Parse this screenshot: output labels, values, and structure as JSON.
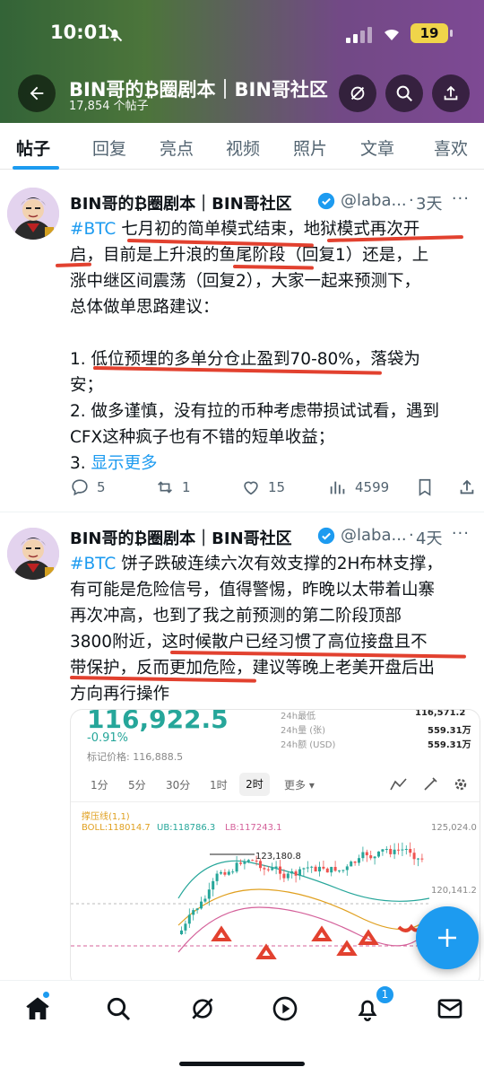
{
  "status_bar": {
    "time": "10:01",
    "battery": "19"
  },
  "header": {
    "title": "BIN哥的₿圈剧本｜BIN哥社区",
    "subtitle": "17,854 个帖子"
  },
  "tabs": [
    {
      "label": "帖子",
      "active": true
    },
    {
      "label": "回复"
    },
    {
      "label": "亮点"
    },
    {
      "label": "视频"
    },
    {
      "label": "照片"
    },
    {
      "label": "文章"
    },
    {
      "label": "喜欢"
    }
  ],
  "posts": [
    {
      "author": "BIN哥的₿圈剧本｜BIN哥社区",
      "handle": "@laba...",
      "time": "3天",
      "lines": [
        [
          "#BTC",
          " 七月初的简单模式结束，地狱模式再次开"
        ],
        [
          "",
          "启，目前是上升浪的鱼尾阶段（回复1）还是，上"
        ],
        [
          "",
          "涨中继区间震荡（回复2），大家一起来预测下，"
        ],
        [
          "",
          "总体做单思路建议："
        ],
        [
          "",
          ""
        ],
        [
          "",
          "1. 低位预埋的多单分仓止盈到70-80%，落袋为"
        ],
        [
          "",
          "安；"
        ],
        [
          "",
          "2. 做多谨慎，没有拉的币种考虑带损试试看，遇到"
        ],
        [
          "",
          "CFX这种疯子也有不错的短单收益；"
        ],
        [
          "",
          "3. "
        ]
      ],
      "show_more": "显示更多",
      "stats": {
        "replies": "5",
        "reposts": "1",
        "likes": "15",
        "views": "4599"
      }
    },
    {
      "author": "BIN哥的₿圈剧本｜BIN哥社区",
      "handle": "@laba...",
      "time": "4天",
      "lines": [
        [
          "#BTC",
          " 饼子跌破连续六次有效支撑的2H布林支撑，"
        ],
        [
          "",
          "有可能是危险信号，值得警惕，昨晚以太带着山寨"
        ],
        [
          "",
          "再次冲高，也到了我之前预测的第二阶段顶部"
        ],
        [
          "",
          "3800附近，这时候散户已经习惯了高位接盘且不"
        ],
        [
          "",
          "带保护，反而更加危险，建议等晚上老美开盘后出"
        ],
        [
          "",
          "方向再行操作"
        ]
      ]
    }
  ],
  "chart_card": {
    "price": "116,922.5",
    "change": "-0.91%",
    "mark_price_label": "标记价格: 116,888.5",
    "stats": [
      {
        "label": "24h最低",
        "value": "116,571.2"
      },
      {
        "label": "24h量 (张)",
        "value": "559.31万"
      },
      {
        "label": "24h额 (USD)",
        "value": "559.31万"
      }
    ],
    "intervals": [
      "1分",
      "5分",
      "30分",
      "1时",
      "2时",
      "更多 ▾"
    ],
    "active_interval": "2时",
    "indicator_label": "撑压线(1,1)",
    "boll": {
      "boll": "BOLL:118014.7",
      "ub": "UB:118786.3",
      "lb": "LB:117243.1"
    },
    "price_axis": [
      "125,024.0",
      "120,141.2"
    ],
    "peak_label": "123,180.8"
  },
  "colors": {
    "accent": "#1d9bf0",
    "underline": "#e2412f",
    "up": "#26a69a",
    "down": "#ef5350"
  }
}
